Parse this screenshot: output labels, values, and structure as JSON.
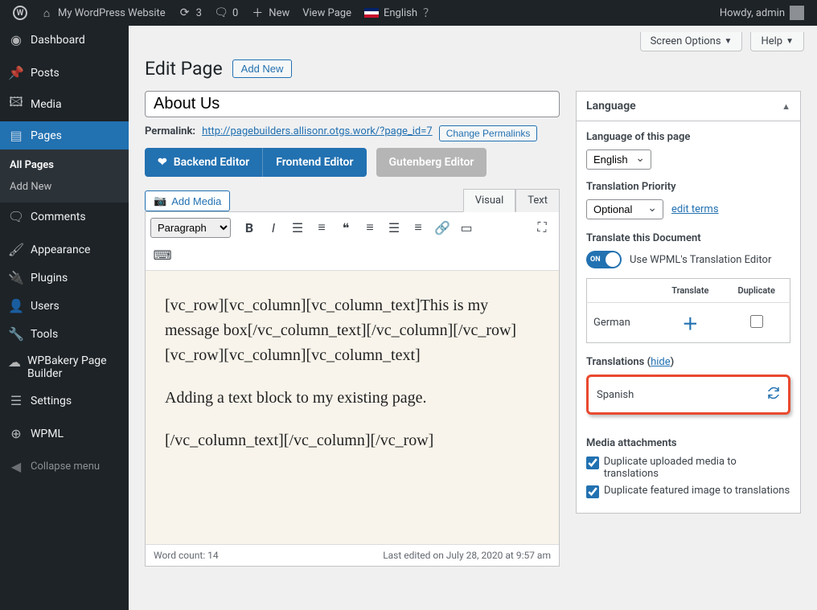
{
  "adminbar": {
    "site_title": "My WordPress Website",
    "updates_count": "3",
    "comments_count": "0",
    "new_label": "New",
    "view_page": "View Page",
    "language": "English",
    "howdy": "Howdy, admin"
  },
  "sidebar": {
    "items": [
      {
        "label": "Dashboard"
      },
      {
        "label": "Posts"
      },
      {
        "label": "Media"
      },
      {
        "label": "Pages"
      },
      {
        "label": "Comments"
      },
      {
        "label": "Appearance"
      },
      {
        "label": "Plugins"
      },
      {
        "label": "Users"
      },
      {
        "label": "Tools"
      },
      {
        "label": "WPBakery Page Builder"
      },
      {
        "label": "Settings"
      },
      {
        "label": "WPML"
      }
    ],
    "submenu": {
      "all_pages": "All Pages",
      "add_new": "Add New"
    },
    "collapse": "Collapse menu"
  },
  "screen_tabs": {
    "screen_options": "Screen Options",
    "help": "Help"
  },
  "page": {
    "heading": "Edit Page",
    "add_new_btn": "Add New",
    "title_value": "About Us",
    "permalink_label": "Permalink:",
    "permalink_url": "http://pagebuilders.allisonr.otgs.work/?page_id=7",
    "change_permalinks": "Change Permalinks"
  },
  "editor_switch": {
    "backend": "Backend Editor",
    "frontend": "Frontend Editor",
    "gutenberg": "Gutenberg Editor"
  },
  "media": {
    "add_media": "Add Media",
    "visual_tab": "Visual",
    "text_tab": "Text"
  },
  "toolbar": {
    "paragraph": "Paragraph"
  },
  "content": {
    "p1": "[vc_row][vc_column][vc_column_text]This is my message box[/vc_column_text][/vc_column][/vc_row][vc_row][vc_column][vc_column_text]",
    "p2": "Adding a text block to my existing page.",
    "p3": "[/vc_column_text][/vc_column][/vc_row]"
  },
  "statusbar": {
    "word_count_label": "Word count: 14",
    "last_edited": "Last edited on July 28, 2020 at 9:57 am"
  },
  "language_box": {
    "title": "Language",
    "lang_of_page_label": "Language of this page",
    "lang_selected": "English",
    "priority_label": "Translation Priority",
    "priority_selected": "Optional",
    "edit_terms": "edit terms",
    "translate_doc_label": "Translate this Document",
    "toggle_on": "ON",
    "toggle_label": "Use WPML's Translation Editor",
    "th_translate": "Translate",
    "th_duplicate": "Duplicate",
    "row_german": "German",
    "translations_label": "Translations",
    "hide_link": "hide",
    "spanish": "Spanish",
    "media_label": "Media attachments",
    "media_opt1": "Duplicate uploaded media to translations",
    "media_opt2": "Duplicate featured image to translations"
  }
}
